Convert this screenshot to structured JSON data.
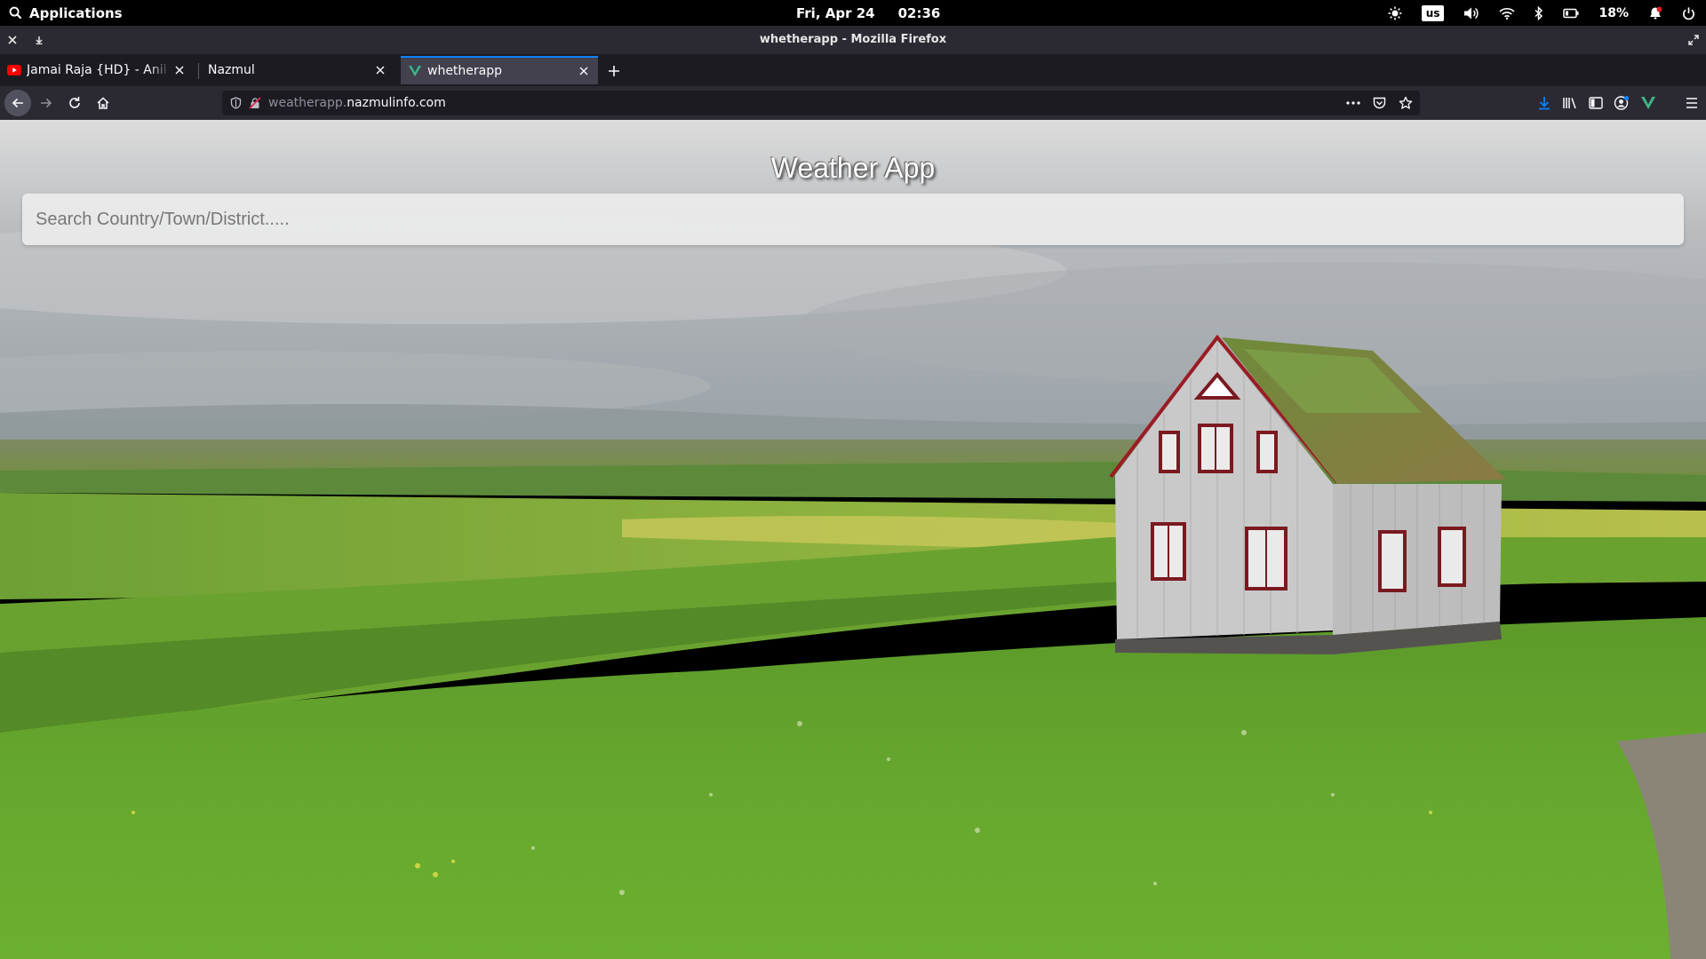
{
  "system_bar": {
    "applications_label": "Applications",
    "date": "Fri, Apr 24",
    "time": "02:36",
    "keyboard_layout": "us",
    "battery_percent": "18%",
    "icons": [
      "search-icon",
      "brightness-icon",
      "volume-icon",
      "wifi-icon",
      "bluetooth-icon",
      "battery-icon",
      "notification-icon",
      "power-icon"
    ]
  },
  "window": {
    "title": "whetherapp - Mozilla Firefox"
  },
  "tabs": [
    {
      "label": "Jamai Raja {HD} - Anil Kapoor",
      "favicon": "youtube-icon",
      "active": false
    },
    {
      "label": "Nazmul",
      "favicon": "none",
      "active": false
    },
    {
      "label": "whetherapp",
      "favicon": "vue-icon",
      "active": true
    }
  ],
  "navbar": {
    "url_subdomain": "weatherapp.",
    "url_domain": "nazmulinfo.com",
    "icons": [
      "back-icon",
      "forward-icon",
      "reload-icon",
      "home-icon",
      "shield-icon",
      "not-secure-icon",
      "page-actions-icon",
      "pocket-icon",
      "bookmark-star-icon",
      "downloads-icon",
      "library-icon",
      "sidebar-icon",
      "account-icon",
      "vue-devtools-icon",
      "menu-icon"
    ]
  },
  "page": {
    "title": "Weather App",
    "search_placeholder": "Search Country/Town/District....."
  },
  "colors": {
    "tab_accent": "#0a84ff",
    "browser_dark": "#1c1b22",
    "toolbar": "#2b2a33",
    "vue_green": "#41b883",
    "grass": "#5f9e2c",
    "sky": "#c9cccf"
  }
}
